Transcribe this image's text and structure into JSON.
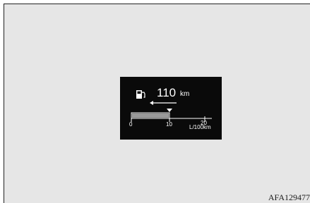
{
  "range_display": {
    "value": "110",
    "unit": "km",
    "fuel_icon": "fuel-pump-icon"
  },
  "consumption_bar": {
    "tick_labels": [
      "0",
      "10",
      "20"
    ],
    "unit": "L/100km",
    "current_value": 10,
    "scale_max": 20
  },
  "figure_code": "AFA129477",
  "colors": {
    "background": "#e6e6e6",
    "display": "#0a0a0a",
    "bar_fill": "#9a9a9a",
    "text": "#ffffff"
  }
}
